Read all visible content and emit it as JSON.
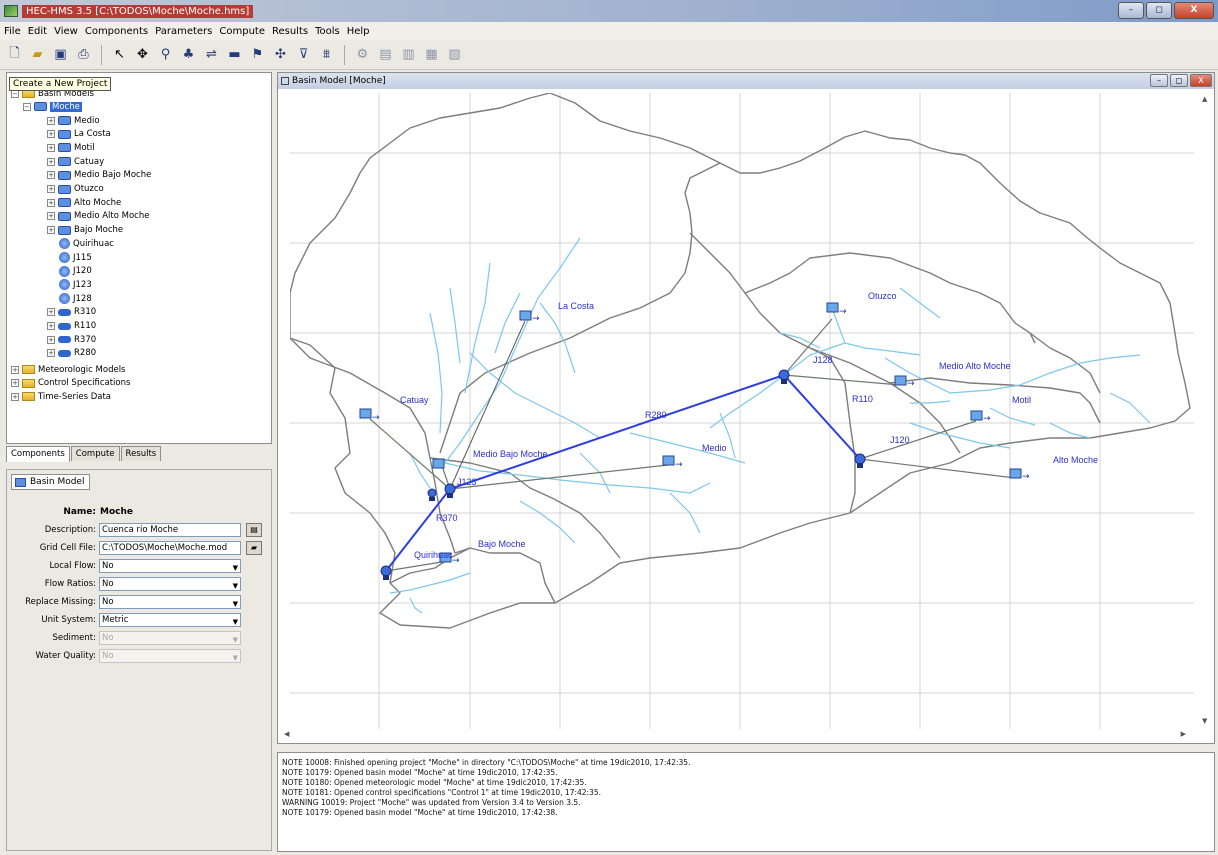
{
  "window": {
    "title": "HEC-HMS 3.5 [C:\\TODOS\\Moche\\Moche.hms]",
    "controls": [
      "–",
      "◻",
      "X"
    ]
  },
  "menu": [
    "File",
    "Edit",
    "View",
    "Components",
    "Parameters",
    "Compute",
    "Results",
    "Tools",
    "Help"
  ],
  "toolbar": {
    "icons": [
      "new-document-icon",
      "open-folder-icon",
      "save-icon",
      "print-icon",
      "arrow-select-icon",
      "pan-icon",
      "zoom-icon",
      "subbasin-icon",
      "reach-icon",
      "reservoir-icon",
      "source-icon",
      "junction-icon",
      "diversion-icon",
      "sink-icon",
      "compute-icon",
      "run-icon",
      "chart-icon",
      "table-icon",
      "summary-icon"
    ],
    "tooltip": "Create a New Project"
  },
  "tree": {
    "root": "Basin Models",
    "selected": "Moche",
    "items": [
      {
        "label": "Medio",
        "kind": "subbasin"
      },
      {
        "label": "La Costa",
        "kind": "subbasin"
      },
      {
        "label": "Motil",
        "kind": "subbasin"
      },
      {
        "label": "Catuay",
        "kind": "subbasin"
      },
      {
        "label": "Medio Bajo Moche",
        "kind": "subbasin"
      },
      {
        "label": "Otuzco",
        "kind": "subbasin"
      },
      {
        "label": "Alto Moche",
        "kind": "subbasin"
      },
      {
        "label": "Medio Alto Moche",
        "kind": "subbasin"
      },
      {
        "label": "Bajo Moche",
        "kind": "subbasin"
      },
      {
        "label": "Quirihuac",
        "kind": "junction"
      },
      {
        "label": "J115",
        "kind": "junction"
      },
      {
        "label": "J120",
        "kind": "junction"
      },
      {
        "label": "J123",
        "kind": "junction"
      },
      {
        "label": "J128",
        "kind": "junction"
      },
      {
        "label": "R310",
        "kind": "reach"
      },
      {
        "label": "R110",
        "kind": "reach"
      },
      {
        "label": "R370",
        "kind": "reach"
      },
      {
        "label": "R280",
        "kind": "reach"
      }
    ],
    "folders": [
      "Meteorologic Models",
      "Control Specifications",
      "Time-Series Data"
    ]
  },
  "tabs": [
    "Components",
    "Compute",
    "Results"
  ],
  "editor": {
    "tab": "Basin Model",
    "name_label": "Name:",
    "name": "Moche",
    "fields": [
      {
        "label": "Description:",
        "value": "Cuenca rio Moche",
        "type": "text"
      },
      {
        "label": "Grid Cell File:",
        "value": "C:\\TODOS\\Moche\\Moche.mod",
        "type": "file"
      },
      {
        "label": "Local Flow:",
        "value": "No",
        "type": "combo"
      },
      {
        "label": "Flow Ratios:",
        "value": "No",
        "type": "combo"
      },
      {
        "label": "Replace Missing:",
        "value": "No",
        "type": "combo"
      },
      {
        "label": "Unit System:",
        "value": "Metric",
        "type": "combo"
      },
      {
        "label": "Sediment:",
        "value": "No",
        "type": "combo-disabled"
      },
      {
        "label": "Water Quality:",
        "value": "No",
        "type": "combo-disabled"
      }
    ]
  },
  "basin_window": {
    "title": "Basin Model [Moche]",
    "labels": {
      "la_costa": "La Costa",
      "otuzco": "Otuzco",
      "j128": "J128",
      "medio_alto_moche": "Medio Alto Moche",
      "r110": "R110",
      "motil": "Motil",
      "j120": "J120",
      "alto_moche": "Alto Moche",
      "catuay": "Catuay",
      "r280": "R280",
      "medio": "Medio",
      "medio_bajo_moche": "Medio Bajo Moche",
      "j123": "J123",
      "r370": "R370",
      "bajo_moche": "Bajo Moche",
      "quirihuac": "Quirihuac"
    }
  },
  "messages": [
    "NOTE 10008:  Finished opening project \"Moche\" in directory \"C:\\TODOS\\Moche\" at time 19dic2010, 17:42:35.",
    "NOTE 10179:  Opened basin model \"Moche\" at time 19dic2010, 17:42:35.",
    "NOTE 10180:  Opened meteorologic model \"Moche\" at time 19dic2010, 17:42:35.",
    "NOTE 10181:  Opened control specifications \"Control 1\" at time 19dic2010, 17:42:35.",
    "WARNING 10019:  Project \"Moche\" was updated from Version 3.4 to Version 3.5.",
    "NOTE 10179:  Opened basin model \"Moche\" at time 19dic2010, 17:42:38."
  ]
}
